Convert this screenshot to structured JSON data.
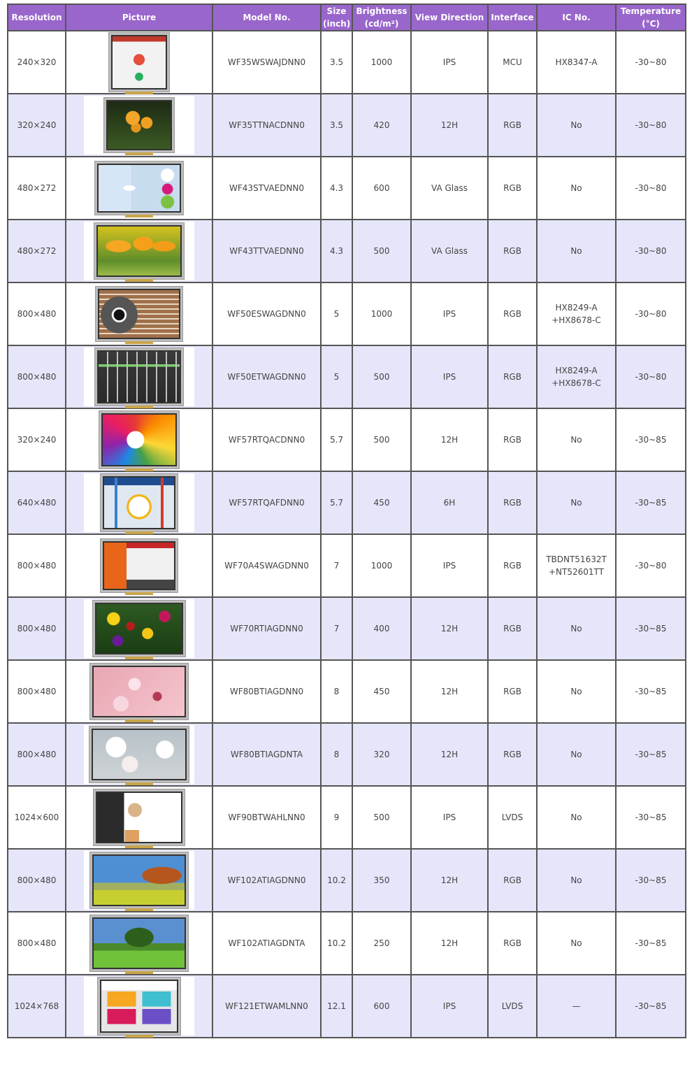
{
  "table": {
    "headers": [
      {
        "line1": "Resolution",
        "line2": ""
      },
      {
        "line1": "Picture",
        "line2": ""
      },
      {
        "line1": "Model No.",
        "line2": ""
      },
      {
        "line1": "Size",
        "line2": "(inch)"
      },
      {
        "line1": "Brightness",
        "line2": "(cd/m²)"
      },
      {
        "line1": "View Direction",
        "line2": ""
      },
      {
        "line1": "Interface",
        "line2": ""
      },
      {
        "line1": "IC No.",
        "line2": ""
      },
      {
        "line1": "Temperature",
        "line2": "(°C)"
      }
    ],
    "colors": {
      "header_bg": "#9966cc",
      "header_text": "#ffffff",
      "alt_row_bg": "#e6e6fa",
      "row_bg": "#ffffff",
      "border": "#555555",
      "text": "#444444"
    },
    "rows": [
      {
        "resolution": "240×320",
        "picture": "lcd-photo-watermelon-ui",
        "model": "WF35WSWAJDNN0",
        "size": "3.5",
        "brightness": "1000",
        "view": "IPS",
        "interface": "MCU",
        "ic1": "HX8347-A",
        "ic2": "",
        "temp": "-30~80"
      },
      {
        "resolution": "320×240",
        "picture": "lcd-photo-yellow-flowers",
        "model": "WF35TTNACDNN0",
        "size": "3.5",
        "brightness": "420",
        "view": "12H",
        "interface": "RGB",
        "ic1": "No",
        "ic2": "",
        "temp": "-30~80"
      },
      {
        "resolution": "480×272",
        "picture": "lcd-photo-body-health-ui",
        "model": "WF43STVAEDNN0",
        "size": "4.3",
        "brightness": "600",
        "view": "VA Glass",
        "interface": "RGB",
        "ic1": "No",
        "ic2": "",
        "temp": "-30~80"
      },
      {
        "resolution": "480×272",
        "picture": "lcd-photo-yellow-tulips",
        "model": "WF43TTVAEDNN0",
        "size": "4.3",
        "brightness": "500",
        "view": "VA Glass",
        "interface": "RGB",
        "ic1": "No",
        "ic2": "",
        "temp": "-30~80"
      },
      {
        "resolution": "800×480",
        "picture": "lcd-photo-eye-scan-ui",
        "model": "WF50ESWAGDNN0",
        "size": "5",
        "brightness": "1000",
        "view": "IPS",
        "interface": "RGB",
        "ic1": "HX8249-A",
        "ic2": "+HX8678-C",
        "temp": "-30~80"
      },
      {
        "resolution": "800×480",
        "picture": "lcd-photo-control-panel-ui",
        "model": "WF50ETWAGDNN0",
        "size": "5",
        "brightness": "500",
        "view": "IPS",
        "interface": "RGB",
        "ic1": "HX8249-A",
        "ic2": "+HX8678-C",
        "temp": "-30~80"
      },
      {
        "resolution": "320×240",
        "picture": "lcd-photo-colored-pencils",
        "model": "WF57RTQACDNN0",
        "size": "5.7",
        "brightness": "500",
        "view": "12H",
        "interface": "RGB",
        "ic1": "No",
        "ic2": "",
        "temp": "-30~85"
      },
      {
        "resolution": "640×480",
        "picture": "lcd-photo-temperature-ui",
        "model": "WF57RTQAFDNN0",
        "size": "5.7",
        "brightness": "450",
        "view": "6H",
        "interface": "RGB",
        "ic1": "No",
        "ic2": "",
        "temp": "-30~85"
      },
      {
        "resolution": "800×480",
        "picture": "lcd-photo-train-ui",
        "model": "WF70A4SWAGDNN0",
        "size": "7",
        "brightness": "1000",
        "view": "IPS",
        "interface": "RGB",
        "ic1": "TBDNT51632T",
        "ic2": "+NT52601TT",
        "temp": "-30~80"
      },
      {
        "resolution": "800×480",
        "picture": "lcd-photo-tulip-field",
        "model": "WF70RTIAGDNN0",
        "size": "7",
        "brightness": "400",
        "view": "12H",
        "interface": "RGB",
        "ic1": "No",
        "ic2": "",
        "temp": "-30~85"
      },
      {
        "resolution": "800×480",
        "picture": "lcd-photo-cherry-blossom-pink",
        "model": "WF80BTIAGDNN0",
        "size": "8",
        "brightness": "450",
        "view": "12H",
        "interface": "RGB",
        "ic1": "No",
        "ic2": "",
        "temp": "-30~85"
      },
      {
        "resolution": "800×480",
        "picture": "lcd-photo-cherry-blossom-white",
        "model": "WF80BTIAGDNTA",
        "size": "8",
        "brightness": "320",
        "view": "12H",
        "interface": "RGB",
        "ic1": "No",
        "ic2": "",
        "temp": "-30~85"
      },
      {
        "resolution": "1024×600",
        "picture": "lcd-photo-recipes-ui",
        "model": "WF90BTWAHLNN0",
        "size": "9",
        "brightness": "500",
        "view": "IPS",
        "interface": "LVDS",
        "ic1": "No",
        "ic2": "",
        "temp": "-30~85"
      },
      {
        "resolution": "800×480",
        "picture": "lcd-photo-autumn-tree",
        "model": "WF102ATIAGDNN0",
        "size": "10.2",
        "brightness": "350",
        "view": "12H",
        "interface": "RGB",
        "ic1": "No",
        "ic2": "",
        "temp": "-30~85"
      },
      {
        "resolution": "800×480",
        "picture": "lcd-photo-green-tree",
        "model": "WF102ATIAGDNTA",
        "size": "10.2",
        "brightness": "250",
        "view": "12H",
        "interface": "RGB",
        "ic1": "No",
        "ic2": "",
        "temp": "-30~85"
      },
      {
        "resolution": "1024×768",
        "picture": "lcd-photo-ticketing-ui",
        "model": "WF121ETWAMLNN0",
        "size": "12.1",
        "brightness": "600",
        "view": "IPS",
        "interface": "LVDS",
        "ic1": "—",
        "ic2": "",
        "temp": "-30~85"
      }
    ]
  }
}
